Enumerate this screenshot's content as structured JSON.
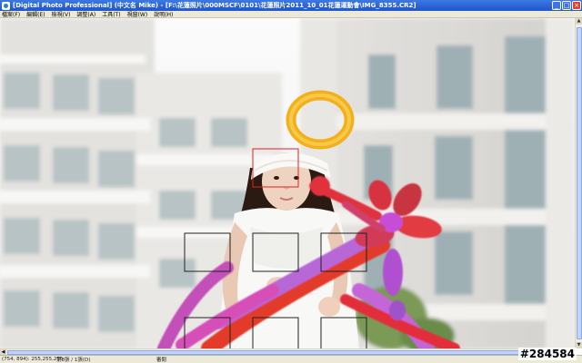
{
  "window": {
    "title": "[Digital Photo Professional] (中文名 Mike) - [F:\\花蓮照片\\000MSCF\\0101\\花蓮照片2011_10_01花蓮運動會\\IMG_8355.CR2]"
  },
  "menu": {
    "items": [
      "檔案(F)",
      "編輯(E)",
      "檢視(V)",
      "調整(A)",
      "工具(T)",
      "視窗(W)",
      "說明(H)"
    ]
  },
  "status": {
    "coords": "(754, 894): 255,255,255",
    "file": "第8張 / 1張(D)",
    "mode": "審閱"
  },
  "watermark": "#284584",
  "colors": {
    "titlebar": "#2358d0",
    "af_point_active": "#e02020",
    "af_point": "#222222"
  }
}
